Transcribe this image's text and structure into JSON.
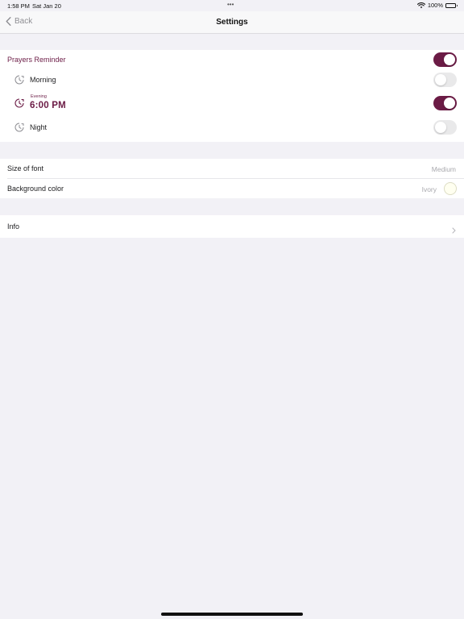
{
  "status_bar": {
    "time": "1:58 PM",
    "date": "Sat Jan 20",
    "multitask_dots": "•••",
    "battery": "100%",
    "battery_level": 1.0
  },
  "nav": {
    "back_label": "Back",
    "title": "Settings"
  },
  "reminders": {
    "header_label": "Prayers Reminder",
    "header_enabled": true,
    "items": [
      {
        "label": "Morning",
        "enabled": false
      },
      {
        "caption": "Evening",
        "time": "6:00 PM",
        "enabled": true
      },
      {
        "label": "Night",
        "enabled": false
      }
    ]
  },
  "appearance": {
    "font_size_label": "Size of font",
    "font_size_value": "Medium",
    "bg_color_label": "Background color",
    "bg_color_value": "Ivory",
    "bg_color_hex": "#fffff0"
  },
  "info": {
    "label": "Info"
  },
  "colors": {
    "accent": "#6b1b45",
    "background": "#f2f1f6",
    "toggle_off": "#e9e9ea"
  },
  "icons": {
    "back": "chevron-left-icon",
    "reminder": "clock-icon",
    "info": "chevron-right-icon",
    "wifi": "wifi-icon",
    "battery": "battery-icon"
  }
}
